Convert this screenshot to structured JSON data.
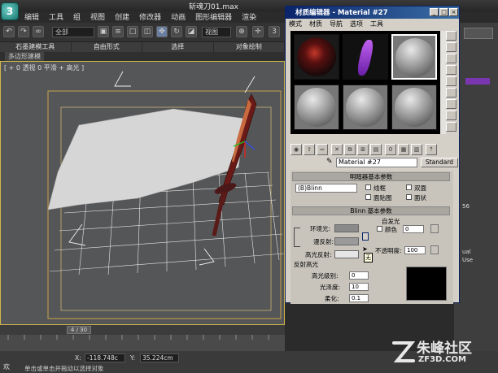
{
  "app": {
    "title": "斩魂刀01.max",
    "menu": [
      "编辑",
      "工具",
      "组",
      "视图",
      "创建",
      "修改器",
      "动画",
      "图形编辑器",
      "渲染"
    ],
    "selection_dropdown": "全部",
    "view_dropdown": "视图"
  },
  "ribbon": {
    "tabs": [
      "石墨建模工具",
      "自由形式",
      "选择",
      "对象绘制"
    ],
    "subtab": "多边形建模"
  },
  "viewport": {
    "label": "[ + 0 透视 0 平滑 + 高光 ]"
  },
  "timeline": {
    "frame": "4 / 30"
  },
  "status": {
    "x_label": "X:",
    "x_value": "-118.748c",
    "y_label": "Y:",
    "y_value": "35.224cm",
    "prompt": "单击或单击并拖动以选择对象",
    "left_tag": "欢"
  },
  "command_panel": {
    "number": "56",
    "ual": "ual",
    "use": "Use"
  },
  "material_editor": {
    "title": "材质编辑器 - Material #27",
    "menu": [
      "模式",
      "材质",
      "导航",
      "选项",
      "工具"
    ],
    "material_name": "Material #27",
    "material_type": "Standard",
    "shader_rollout": "明暗器基本参数",
    "shader": "(B)Blinn",
    "shader_options": [
      "线框",
      "双面",
      "面贴图",
      "面状"
    ],
    "blinn_rollout": "Blinn 基本参数",
    "self_illum": "自发光",
    "color_label": "颜色",
    "self_illum_value": "0",
    "ambient": "环境光:",
    "diffuse": "漫反射:",
    "specular": "高光反射:",
    "opacity_label": "不透明度:",
    "opacity_value": "100",
    "map_button": "M",
    "cursor_hint": "无",
    "spec_highlights": "反射高光",
    "spec_level": "高光级别:",
    "spec_level_value": "0",
    "glossiness": "光泽度:",
    "glossiness_value": "10",
    "soften": "柔化:",
    "soften_value": "0.1"
  },
  "watermark": {
    "text": "朱峰社区",
    "url": "ZF3D.COM"
  },
  "colors": {
    "accent_blue": "#0a246a",
    "viewport_border": "#d2b64a",
    "grid": "#e8e8e8"
  }
}
